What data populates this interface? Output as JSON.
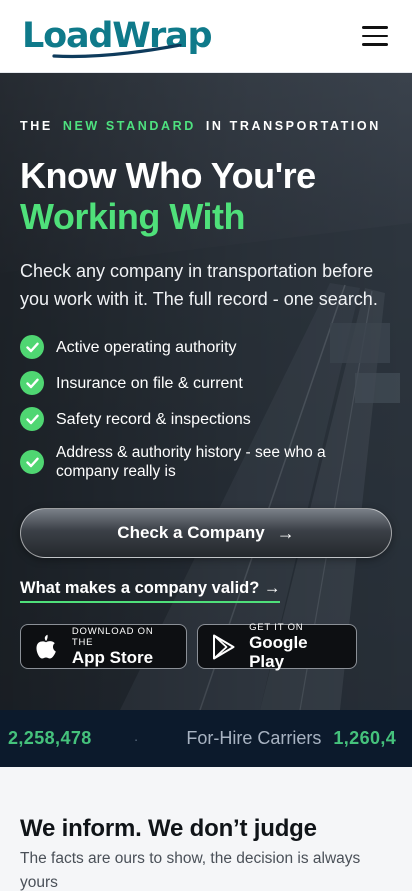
{
  "header": {
    "logo_text": "LoadWrap",
    "menu_icon": "hamburger-menu-icon"
  },
  "hero": {
    "eyebrow_prefix": "THE",
    "eyebrow_highlight": "NEW STANDARD",
    "eyebrow_suffix": "IN TRANSPORTATION",
    "title_line1": "Know Who You're",
    "title_line2": "Working With",
    "subtitle": "Check any company in transportation before you work with it. The full record - one search.",
    "features": [
      "Active operating authority",
      "Insurance on file & current",
      "Safety record & inspections",
      "Address & authority history - see who a company really is"
    ],
    "cta_label": "Check a Company",
    "cta_arrow": "→",
    "valid_link": "What makes a company valid? →",
    "app_store": {
      "small": "DOWNLOAD ON THE",
      "big": "App Store"
    },
    "google_play": {
      "small": "GET IT ON",
      "big": "Google Play"
    }
  },
  "ticker": {
    "items": [
      {
        "value": "2,258,478",
        "label": ""
      },
      {
        "value": "1,260,4",
        "label": "For-Hire Carriers"
      }
    ],
    "separator": "·"
  },
  "section": {
    "title": "We inform. We don’t judge",
    "subtitle": "The facts are ours to show, the decision is always yours"
  },
  "colors": {
    "brand_teal": "#0f7a8a",
    "accent_green": "#4fe07a",
    "ticker_bg": "#0c1a2c",
    "ticker_number": "#45c27c"
  }
}
